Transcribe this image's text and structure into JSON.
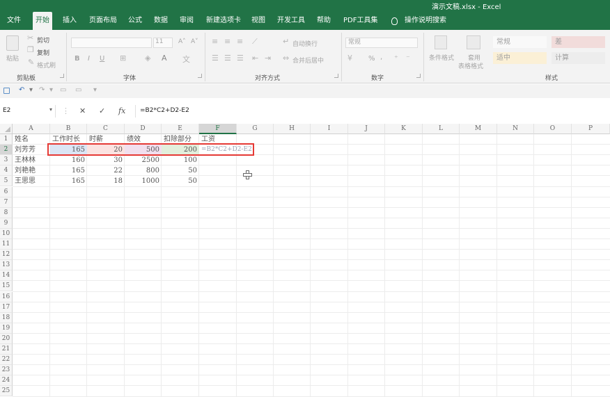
{
  "window": {
    "title": "演示文稿.xlsx  -  Excel"
  },
  "tabs": [
    "文件",
    "开始",
    "插入",
    "页面布局",
    "公式",
    "数据",
    "审阅",
    "新建选项卡",
    "视图",
    "开发工具",
    "帮助",
    "PDF工具集",
    "操作说明搜索"
  ],
  "active_tab": "开始",
  "ribbon": {
    "clipboard": {
      "paste": "粘贴",
      "cut": "剪切",
      "copy": "复制",
      "format_painter": "格式刷",
      "label": "剪贴板"
    },
    "font": {
      "size": "11",
      "bold": "B",
      "italic": "I",
      "underline": "U",
      "label": "字体"
    },
    "alignment": {
      "wrap": "自动换行",
      "merge": "合并后居中",
      "label": "对齐方式"
    },
    "number": {
      "format": "常规",
      "percent": "%",
      "comma": ",",
      "label": "数字"
    },
    "styles": {
      "conditional": "条件格式",
      "table_format_1": "套用",
      "table_format_2": "表格格式",
      "normal": "常规",
      "bad": "差",
      "neutral": "适中",
      "calc": "计算",
      "label": "样式"
    }
  },
  "formula_bar": {
    "name_box": "E2",
    "cancel": "✕",
    "enter": "✓",
    "fx": "fx",
    "formula": "=B2*C2+D2-E2"
  },
  "columns": [
    "A",
    "B",
    "C",
    "D",
    "E",
    "F",
    "G",
    "H",
    "I",
    "J",
    "K",
    "L",
    "M",
    "N",
    "O",
    "P"
  ],
  "rows": [
    "1",
    "2",
    "3",
    "4",
    "5",
    "6",
    "7",
    "8",
    "9",
    "10",
    "11",
    "12",
    "13",
    "14",
    "15",
    "16",
    "17",
    "18",
    "19",
    "20",
    "21",
    "22",
    "23",
    "24",
    "25"
  ],
  "headers": [
    "姓名",
    "工作时长",
    "时薪",
    "绩效",
    "扣除部分",
    "工资"
  ],
  "data": [
    {
      "name": "刘芳芳",
      "hours": "165",
      "rate": "20",
      "perf": "500",
      "deduct": "200",
      "salary": "=B2*C2+D2-E2"
    },
    {
      "name": "王林林",
      "hours": "160",
      "rate": "30",
      "perf": "2500",
      "deduct": "100",
      "salary": ""
    },
    {
      "name": "刘艳艳",
      "hours": "165",
      "rate": "22",
      "perf": "800",
      "deduct": "50",
      "salary": ""
    },
    {
      "name": "王思思",
      "hours": "165",
      "rate": "18",
      "perf": "1000",
      "deduct": "50",
      "salary": ""
    }
  ],
  "highlight_colors": {
    "B": "#dbe5f5",
    "C": "#fbe3e1",
    "D": "#f1dfee",
    "E": "#e2efdc"
  },
  "selection_border": "#e53935"
}
